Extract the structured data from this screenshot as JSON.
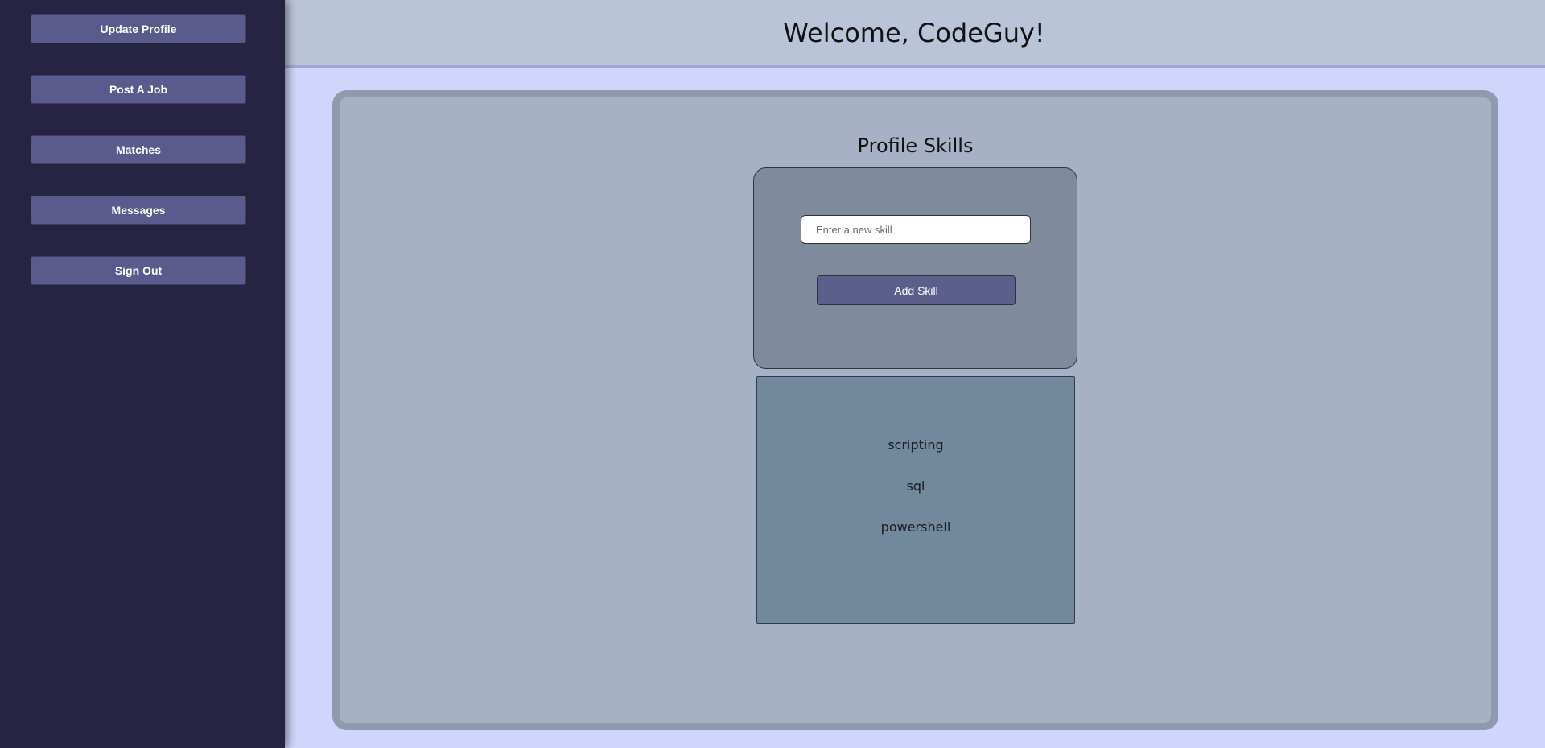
{
  "sidebar": {
    "items": [
      {
        "label": "Update Profile"
      },
      {
        "label": "Post A Job"
      },
      {
        "label": "Matches"
      },
      {
        "label": "Messages"
      },
      {
        "label": "Sign Out"
      }
    ]
  },
  "header": {
    "title": "Welcome, CodeGuy!"
  },
  "main": {
    "title": "Profile Skills",
    "skill_input": {
      "value": "",
      "placeholder": "Enter a new skill"
    },
    "add_skill_label": "Add Skill",
    "skills": [
      "scripting",
      "sql",
      "powershell"
    ]
  },
  "colors": {
    "sidebar_bg": "#272443",
    "nav_button": "#5b5a8c",
    "header_bg": "#bac4d9",
    "page_bg": "#cfd5fb",
    "panel_bg": "#a7b1c6",
    "form_bg": "#808a9d",
    "skills_bg": "#72889c"
  }
}
